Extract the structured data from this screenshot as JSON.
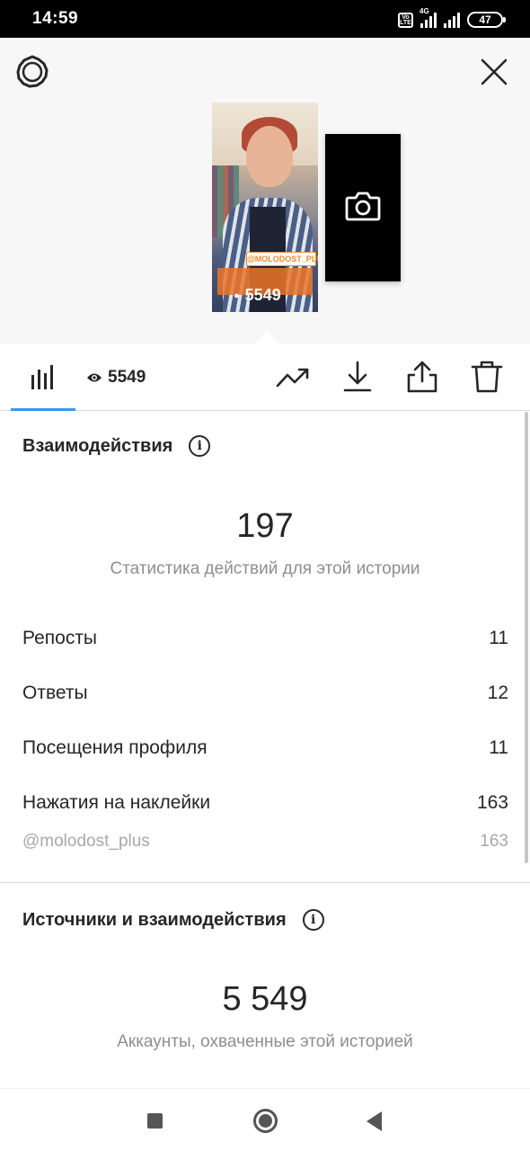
{
  "status_bar": {
    "time": "14:59",
    "volte_label": "Vo LTE",
    "network_label": "4G",
    "battery": "47"
  },
  "header": {
    "settings_icon": "settings-gear-icon",
    "close_icon": "close-icon"
  },
  "story_preview": {
    "sticker_label": "@MOLODOST_PLUS",
    "views": "5549",
    "camera_icon": "camera-icon"
  },
  "toolbar": {
    "insights_icon": "bar-chart-icon",
    "views_count": "5549",
    "promote_icon": "trending-up-icon",
    "download_icon": "download-icon",
    "share_icon": "share-icon",
    "delete_icon": "trash-icon"
  },
  "interactions": {
    "title": "Взаимодействия",
    "total": "197",
    "caption": "Статистика действий для этой истории",
    "rows": [
      {
        "label": "Репосты",
        "value": "11"
      },
      {
        "label": "Ответы",
        "value": "12"
      },
      {
        "label": "Посещения профиля",
        "value": "11"
      },
      {
        "label": "Нажатия на наклейки",
        "value": "163"
      }
    ],
    "sub_row": {
      "label": "@molodost_plus",
      "value": "163"
    }
  },
  "discovery": {
    "title": "Источники и взаимодействия",
    "total": "5 549",
    "caption": "Аккаунты, охваченные этой историей"
  },
  "colors": {
    "accent": "#3897f0",
    "text": "#262626",
    "secondary_text": "#8e8e8e",
    "preview_bg": "#f7f7f7"
  }
}
